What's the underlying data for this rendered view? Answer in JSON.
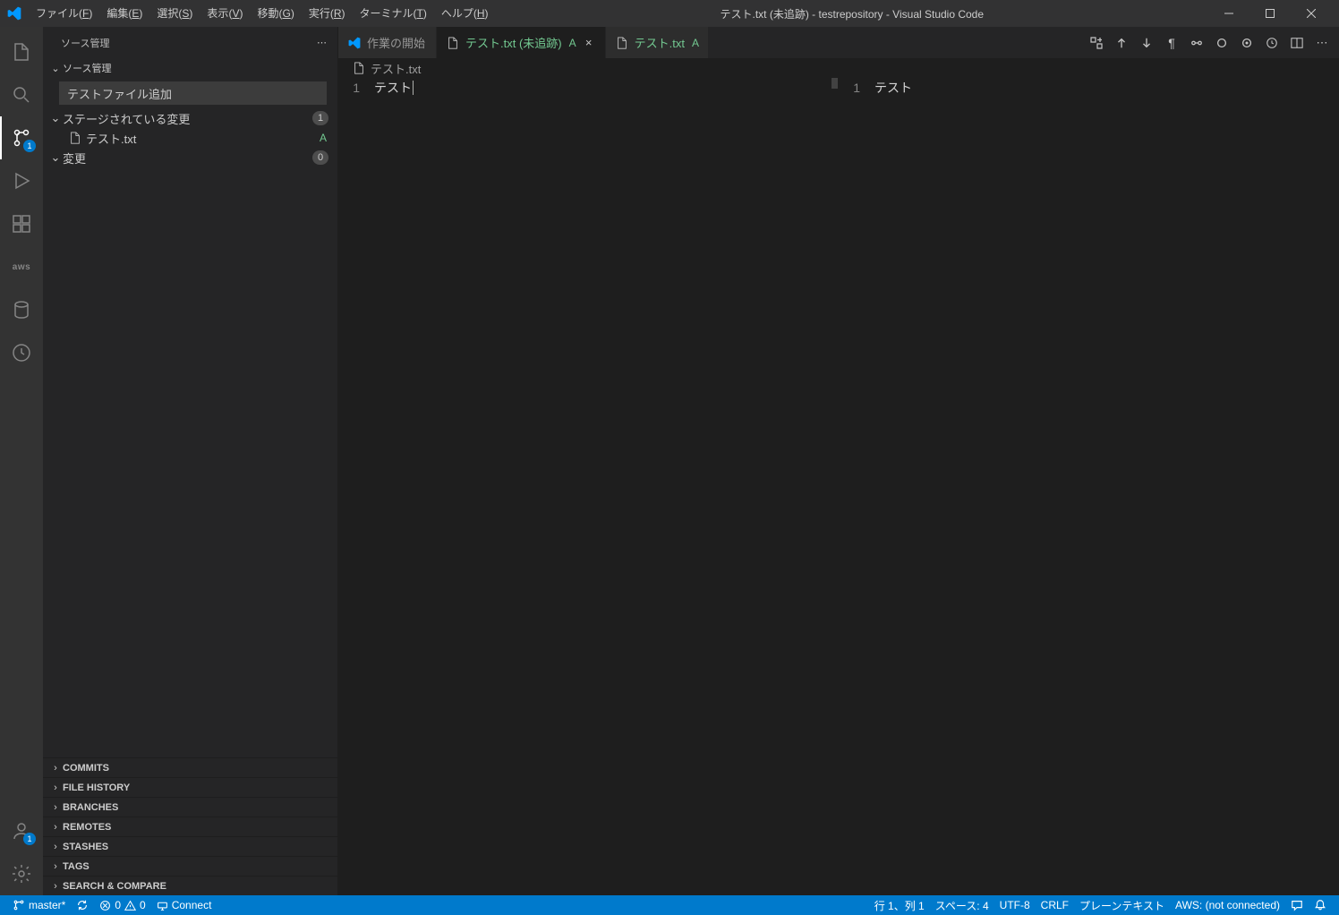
{
  "titlebar": {
    "title": "テスト.txt (未追跡) - testrepository - Visual Studio Code",
    "menu": {
      "file": "ファイル",
      "file_m": "F",
      "edit": "編集",
      "edit_m": "E",
      "selection": "選択",
      "selection_m": "S",
      "view": "表示",
      "view_m": "V",
      "go": "移動",
      "go_m": "G",
      "run": "実行",
      "run_m": "R",
      "terminal": "ターミナル",
      "terminal_m": "T",
      "help": "ヘルプ",
      "help_m": "H"
    }
  },
  "activitybar": {
    "scm_badge": "1",
    "accounts_badge": "1"
  },
  "sidebar": {
    "title": "ソース管理",
    "section_title": "ソース管理",
    "commit_input_value": "テストファイル追加",
    "staged_label": "ステージされている変更",
    "staged_count": "1",
    "staged_file_name": "テスト.txt",
    "staged_file_status": "A",
    "changes_label": "変更",
    "changes_count": "0",
    "bottom": [
      "COMMITS",
      "FILE HISTORY",
      "BRANCHES",
      "REMOTES",
      "STASHES",
      "TAGS",
      "SEARCH & COMPARE"
    ]
  },
  "tabs": {
    "t0_label": "作業の開始",
    "t1_label": "テスト.txt (未追跡)",
    "t1_suffix": "A",
    "t2_label": "テスト.txt",
    "t2_suffix": "A"
  },
  "breadcrumb": {
    "file": "テスト.txt"
  },
  "editor": {
    "left_line_1_num": "1",
    "left_line_1_text": "テスト",
    "right_line_1_num": "1",
    "right_line_1_text": "テスト"
  },
  "statusbar": {
    "branch": "master*",
    "sync": "",
    "errors": "0",
    "warnings": "0",
    "connect": "Connect",
    "cursor": "行 1、列 1",
    "spaces": "スペース: 4",
    "encoding": "UTF-8",
    "eol": "CRLF",
    "lang": "プレーンテキスト",
    "aws": "AWS: (not connected)"
  }
}
